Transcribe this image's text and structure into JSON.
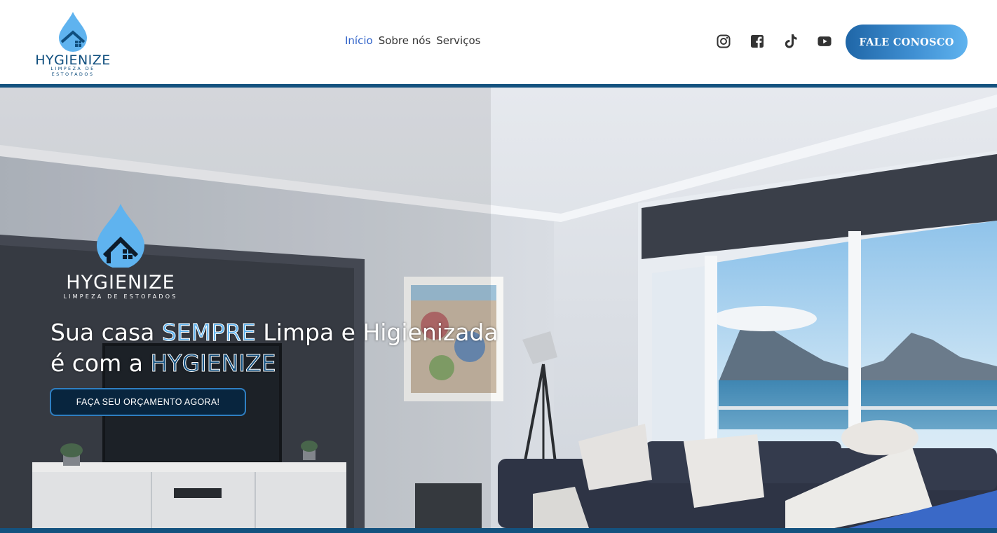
{
  "header": {
    "brand": "HYGIENIZE",
    "tagline": "LIMPEZA DE ESTOFADOS",
    "nav": [
      {
        "label": "Início",
        "active": true
      },
      {
        "label": "Sobre nós",
        "active": false
      },
      {
        "label": "Serviços",
        "active": false
      }
    ],
    "socials": [
      "instagram-icon",
      "facebook-icon",
      "tiktok-icon",
      "youtube-icon"
    ],
    "cta_label": "FALE CONOSCO"
  },
  "hero": {
    "brand": "HYGIENIZE",
    "tagline": "LIMPEZA DE ESTOFADOS",
    "headline_part1": "Sua casa ",
    "headline_highlight1": "SEMPRE",
    "headline_part2": " Limpa e Higienizada é com a ",
    "headline_highlight2": "HYGIENIZE",
    "button_label": "FAÇA SEU ORÇAMENTO AGORA!"
  },
  "colors": {
    "brand_dark": "#0f4e7e",
    "brand_light": "#5fb3ef",
    "nav_active": "#2f62c9",
    "header_line": "#14527f"
  }
}
